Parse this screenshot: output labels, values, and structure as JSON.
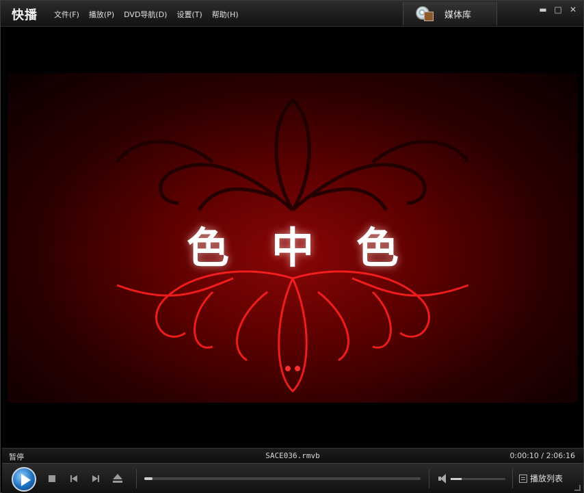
{
  "app": {
    "title": "快播"
  },
  "menu": [
    {
      "label": "文件(F)"
    },
    {
      "label": "播放(P)"
    },
    {
      "label": "DVD导航(D)"
    },
    {
      "label": "设置(T)"
    },
    {
      "label": "帮助(H)"
    }
  ],
  "library": {
    "label": "媒体库",
    "icon": "media-library-icon"
  },
  "window_controls": {
    "minimize": "▬",
    "maximize": "□",
    "close": "✕"
  },
  "video": {
    "title_text": "色中色"
  },
  "status": {
    "state": "暂停",
    "filename": "SACE036.rmvb",
    "time": "0:00:10 / 2:06:16"
  },
  "playback": {
    "progress_fraction": 0.0013,
    "volume_fraction": 0.2
  },
  "controls": {
    "playlist_label": "播放列表"
  },
  "colors": {
    "accent": "#1c6fc0",
    "frame_red": "#8a0606"
  }
}
